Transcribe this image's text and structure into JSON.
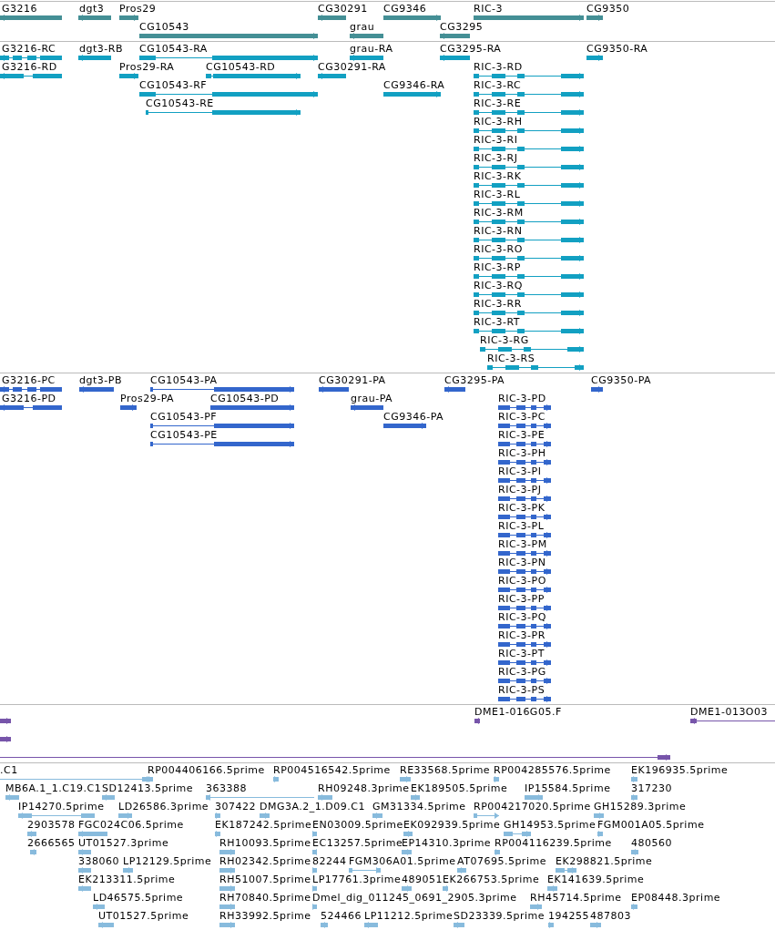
{
  "tracks": [
    {
      "kind": "gene",
      "color": "#448f95",
      "features": [
        {
          "label": "G3216",
          "reverse": true
        },
        {
          "label": "dgt3",
          "reverse": true
        },
        {
          "label": "Pros29",
          "reverse": false
        },
        {
          "label": "CG30291",
          "reverse": true
        },
        {
          "label": "CG9346",
          "reverse": false
        },
        {
          "label": "RIC-3",
          "reverse": false
        },
        {
          "label": "CG9350",
          "reverse": false
        },
        {
          "label": "CG10543",
          "reverse": false
        },
        {
          "label": "grau",
          "reverse": true
        },
        {
          "label": "CG3295",
          "reverse": true
        }
      ]
    },
    {
      "kind": "transcript",
      "color": "#12a0c2",
      "features": [
        {
          "label": "G3216-RC",
          "reverse": true
        },
        {
          "label": "dgt3-RB",
          "reverse": true
        },
        {
          "label": "CG10543-RA",
          "reverse": false
        },
        {
          "label": "grau-RA",
          "reverse": true
        },
        {
          "label": "CG3295-RA",
          "reverse": true
        },
        {
          "label": "CG9350-RA",
          "reverse": false
        },
        {
          "label": "G3216-RD",
          "reverse": true
        },
        {
          "label": "Pros29-RA",
          "reverse": false
        },
        {
          "label": "CG10543-RD",
          "reverse": false
        },
        {
          "label": "CG30291-RA",
          "reverse": true
        },
        {
          "label": "RIC-3-RD",
          "reverse": false
        },
        {
          "label": "CG10543-RF",
          "reverse": false
        },
        {
          "label": "CG9346-RA",
          "reverse": false
        },
        {
          "label": "RIC-3-RC",
          "reverse": false
        },
        {
          "label": "CG10543-RE",
          "reverse": false
        },
        {
          "label": "RIC-3-RE",
          "reverse": false
        },
        {
          "label": "RIC-3-RH",
          "reverse": false
        },
        {
          "label": "RIC-3-RI",
          "reverse": false
        },
        {
          "label": "RIC-3-RJ",
          "reverse": false
        },
        {
          "label": "RIC-3-RK",
          "reverse": false
        },
        {
          "label": "RIC-3-RL",
          "reverse": false
        },
        {
          "label": "RIC-3-RM",
          "reverse": false
        },
        {
          "label": "RIC-3-RN",
          "reverse": false
        },
        {
          "label": "RIC-3-RO",
          "reverse": false
        },
        {
          "label": "RIC-3-RP",
          "reverse": false
        },
        {
          "label": "RIC-3-RQ",
          "reverse": false
        },
        {
          "label": "RIC-3-RR",
          "reverse": false
        },
        {
          "label": "RIC-3-RT",
          "reverse": false
        },
        {
          "label": "RIC-3-RG",
          "reverse": false
        },
        {
          "label": "RIC-3-RS",
          "reverse": false
        }
      ]
    },
    {
      "kind": "protein",
      "color": "#3366cc",
      "features": [
        {
          "label": "G3216-PC",
          "reverse": true
        },
        {
          "label": "dgt3-PB",
          "reverse": true
        },
        {
          "label": "CG10543-PA",
          "reverse": false
        },
        {
          "label": "CG30291-PA",
          "reverse": true
        },
        {
          "label": "CG3295-PA",
          "reverse": true
        },
        {
          "label": "CG9350-PA",
          "reverse": false
        },
        {
          "label": "G3216-PD",
          "reverse": true
        },
        {
          "label": "Pros29-PA",
          "reverse": false
        },
        {
          "label": "CG10543-PD",
          "reverse": false
        },
        {
          "label": "grau-PA",
          "reverse": true
        },
        {
          "label": "RIC-3-PD",
          "reverse": false
        },
        {
          "label": "CG10543-PF",
          "reverse": false
        },
        {
          "label": "CG9346-PA",
          "reverse": false
        },
        {
          "label": "RIC-3-PC",
          "reverse": false
        },
        {
          "label": "CG10543-PE",
          "reverse": false
        },
        {
          "label": "RIC-3-PE",
          "reverse": false
        },
        {
          "label": "RIC-3-PH",
          "reverse": false
        },
        {
          "label": "RIC-3-PI",
          "reverse": false
        },
        {
          "label": "RIC-3-PJ",
          "reverse": false
        },
        {
          "label": "RIC-3-PK",
          "reverse": false
        },
        {
          "label": "RIC-3-PL",
          "reverse": false
        },
        {
          "label": "RIC-3-PM",
          "reverse": false
        },
        {
          "label": "RIC-3-PN",
          "reverse": false
        },
        {
          "label": "RIC-3-PO",
          "reverse": false
        },
        {
          "label": "RIC-3-PP",
          "reverse": false
        },
        {
          "label": "RIC-3-PQ",
          "reverse": false
        },
        {
          "label": "RIC-3-PR",
          "reverse": false
        },
        {
          "label": "RIC-3-PT",
          "reverse": false
        },
        {
          "label": "RIC-3-PG",
          "reverse": false
        },
        {
          "label": "RIC-3-PS",
          "reverse": false
        }
      ]
    },
    {
      "kind": "clone",
      "color": "#7755aa",
      "features": [
        {
          "reverse": false
        },
        {
          "label": "DME1-016G05.F",
          "reverse": true
        },
        {
          "label": "DME1-013O03",
          "reverse": true
        },
        {
          "reverse": false
        },
        {
          "reverse": false
        }
      ]
    },
    {
      "kind": "est",
      "color": "#88bbdd",
      "features": [
        {
          "label": ".C1",
          "reverse": false
        },
        {
          "label": "RP004406166.5prime",
          "reverse": false
        },
        {
          "label": "RP004516542.5prime",
          "reverse": false
        },
        {
          "label": "RE33568.5prime",
          "reverse": false
        },
        {
          "label": "RP004285576.5prime",
          "reverse": false
        },
        {
          "label": "EK196935.5prime",
          "reverse": false
        },
        {
          "label": "MB6A.1_1.C19.C1",
          "reverse": true
        },
        {
          "label": "SD12413.5prime",
          "reverse": true
        },
        {
          "label": "363388",
          "reverse": true
        },
        {
          "label": "RH09248.3prime",
          "reverse": true
        },
        {
          "label": "EK189505.5prime",
          "reverse": false
        },
        {
          "label": "IP15584.5prime",
          "reverse": false
        },
        {
          "label": "317230",
          "reverse": false
        },
        {
          "label": "IP14270.5prime",
          "reverse": true
        },
        {
          "label": "LD26586.3prime",
          "reverse": false
        },
        {
          "label": "307422",
          "reverse": false
        },
        {
          "label": "DMG3A.2_1.D09.C1",
          "reverse": false
        },
        {
          "label": "GM31334.5prime",
          "reverse": true
        },
        {
          "label": "RP004217020.5prime",
          "reverse": false
        },
        {
          "label": "GH15289.3prime",
          "reverse": false
        },
        {
          "label": "2903578",
          "reverse": true
        },
        {
          "label": "FGC024C06.5prime",
          "reverse": true
        },
        {
          "label": "EK187242.5prime",
          "reverse": false
        },
        {
          "label": "EN03009.5prime",
          "reverse": false
        },
        {
          "label": "EK092939.5prime",
          "reverse": false
        },
        {
          "label": "GH14953.5prime",
          "reverse": false
        },
        {
          "label": "FGM001A05.5prime",
          "reverse": false
        },
        {
          "label": "2666565",
          "reverse": true
        },
        {
          "label": "UT01527.3prime",
          "reverse": true
        },
        {
          "label": "RH10093.5prime",
          "reverse": false
        },
        {
          "label": "EC13257.5prime",
          "reverse": true
        },
        {
          "label": "EP14310.3prime",
          "reverse": false
        },
        {
          "label": "RP004116239.5prime",
          "reverse": false
        },
        {
          "label": "480560",
          "reverse": true
        },
        {
          "label": "338060",
          "reverse": true
        },
        {
          "label": "LP12129.5prime",
          "reverse": false
        },
        {
          "label": "RH02342.5prime",
          "reverse": false
        },
        {
          "label": "82244",
          "reverse": false
        },
        {
          "label": "FGM306A01.5prime",
          "reverse": false
        },
        {
          "label": "AT07695.5prime",
          "reverse": true
        },
        {
          "label": "EK298821.5prime",
          "reverse": false
        },
        {
          "label": "EK213311.5prime",
          "reverse": true
        },
        {
          "label": "RH51007.5prime",
          "reverse": false
        },
        {
          "label": "LP17761.3prime",
          "reverse": false
        },
        {
          "label": "489051",
          "reverse": false
        },
        {
          "label": "EK266753.5prime",
          "reverse": true
        },
        {
          "label": "EK141639.5prime",
          "reverse": false
        },
        {
          "label": "LD46575.5prime",
          "reverse": true
        },
        {
          "label": "RH70840.5prime",
          "reverse": false
        },
        {
          "label": "Dmel_dig_011245_0691_2905.3prime",
          "reverse": false
        },
        {
          "label": "RH45714.5prime",
          "reverse": false
        },
        {
          "label": "EP08448.3prime",
          "reverse": false
        },
        {
          "label": "UT01527.5prime",
          "reverse": true
        },
        {
          "label": "RH33992.5prime",
          "reverse": false
        },
        {
          "label": "524466",
          "reverse": true
        },
        {
          "label": "LP11212.5prime",
          "reverse": true
        },
        {
          "label": "SD23339.5prime",
          "reverse": true
        },
        {
          "label": "194255",
          "reverse": false
        },
        {
          "label": "487803",
          "reverse": false
        }
      ]
    }
  ]
}
